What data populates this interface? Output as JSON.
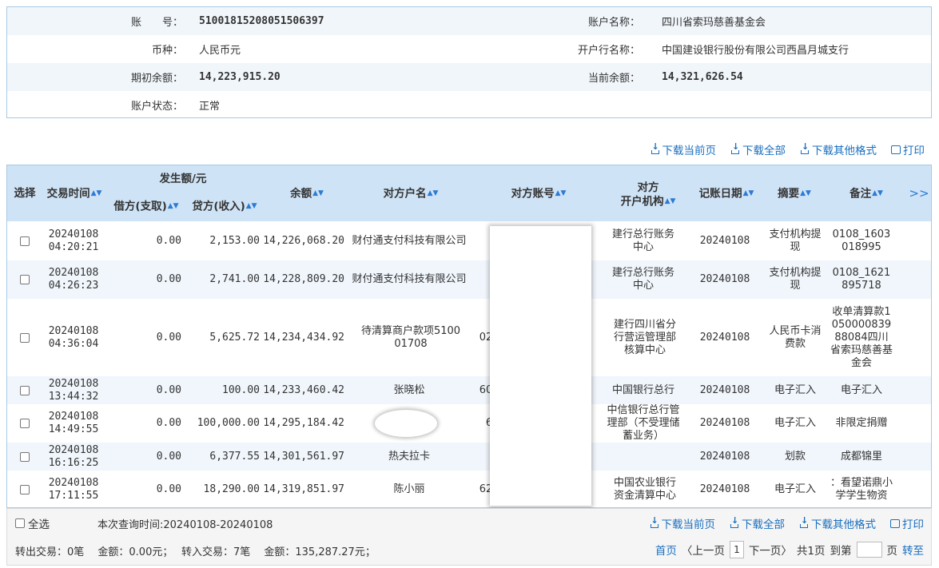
{
  "account": {
    "number_label": "账　　号：",
    "number": "51001815208051506397",
    "name_label": "账户名称：",
    "name": "四川省索玛慈善基金会",
    "currency_label": "币种：",
    "currency": "人民币元",
    "bank_label": "开户行名称：",
    "bank": "中国建设银行股份有限公司西昌月城支行",
    "opening_label": "期初余额：",
    "opening": "14,223,915.20",
    "current_label": "当前余额：",
    "current": "14,321,626.54",
    "status_label": "账户状态：",
    "status": "正常"
  },
  "toolbar": {
    "download_page": "下载当前页",
    "download_all": "下载全部",
    "download_other": "下载其他格式",
    "print": "打印"
  },
  "table": {
    "headers": {
      "select": "选择",
      "time": "交易时间",
      "amount_group": "发生额/元",
      "debit": "借方(支取)",
      "credit": "贷方(收入)",
      "balance": "余额",
      "counterparty_name": "对方户名",
      "counterparty_account": "对方账号",
      "counterparty_bank_l1": "对方",
      "counterparty_bank_l2": "开户机构",
      "post_date": "记账日期",
      "summary": "摘要",
      "remark": "备注",
      "more": ">>"
    },
    "rows": [
      {
        "time1": "20240108",
        "time2": "04:20:21",
        "debit": "0.00",
        "credit": "2,153.00",
        "balance": "14,226,068.20",
        "name": "财付通支付科技有限公司",
        "acct": "",
        "bank": "建行总行账务中心",
        "date": "20240108",
        "summary": "支付机构提现",
        "remark": "0108_1603018995"
      },
      {
        "time1": "20240108",
        "time2": "04:26:23",
        "debit": "0.00",
        "credit": "2,741.00",
        "balance": "14,228,809.20",
        "name": "财付通支付科技有限公司",
        "acct": "",
        "bank": "建行总行账务中心",
        "date": "20240108",
        "summary": "支付机构提现",
        "remark": "0108_1621895718"
      },
      {
        "time1": "20240108",
        "time2": "04:36:04",
        "debit": "0.00",
        "credit": "5,625.72",
        "balance": "14,234,434.92",
        "name": "待清算商户款项510001708",
        "acct": "02",
        "bank": "建行四川省分行营运管理部核算中心",
        "date": "20240108",
        "summary": "人民币卡消费款",
        "remark": "收单清算款105000083988084四川省索玛慈善基金会"
      },
      {
        "time1": "20240108",
        "time2": "13:44:32",
        "debit": "0.00",
        "credit": "100.00",
        "balance": "14,233,460.42",
        "name": "张晓松",
        "acct": "60",
        "bank": "中国银行总行",
        "date": "20240108",
        "summary": "电子汇入",
        "remark": "电子汇入"
      },
      {
        "time1": "20240108",
        "time2": "14:49:55",
        "debit": "0.00",
        "credit": "100,000.00",
        "balance": "14,295,184.42",
        "name": "",
        "acct": "6",
        "bank": "中信银行总行管理部（不受理储蓄业务）",
        "date": "20240108",
        "summary": "电子汇入",
        "remark": "非限定捐赠"
      },
      {
        "time1": "20240108",
        "time2": "16:16:25",
        "debit": "0.00",
        "credit": "6,377.55",
        "balance": "14,301,561.97",
        "name": "热夫拉卡",
        "acct": "",
        "bank": "",
        "date": "20240108",
        "summary": "划款",
        "remark": "成都锦里"
      },
      {
        "time1": "20240108",
        "time2": "17:11:55",
        "debit": "0.00",
        "credit": "18,290.00",
        "balance": "14,319,851.97",
        "name": "陈小丽",
        "acct": "62",
        "bank": "中国农业银行资金清算中心",
        "date": "20240108",
        "summary": "电子汇入",
        "remark": "：看望诺鼎小学学生物资"
      }
    ]
  },
  "footer": {
    "select_all": "全选",
    "query_time": "本次查询时间:20240108-20240108",
    "summary": "转出交易：0笔　 金额：0.00元；　 转入交易：7笔　 金额：135,287.27元；",
    "first": "首页",
    "prev": "〈上一页",
    "page": "1",
    "next": "下一页〉",
    "total": "共1页",
    "goto_label": "到第",
    "goto_unit": "页",
    "go": "转至"
  }
}
